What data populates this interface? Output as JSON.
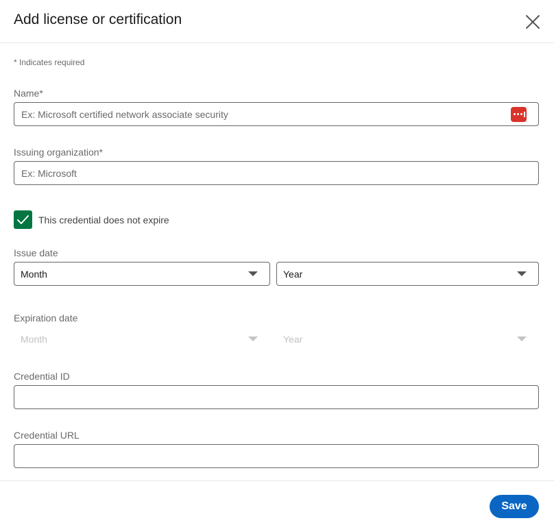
{
  "modal": {
    "title": "Add license or certification",
    "required_note": "* Indicates required"
  },
  "fields": {
    "name": {
      "label": "Name*",
      "placeholder": "Ex: Microsoft certified network associate security",
      "value": ""
    },
    "issuing_org": {
      "label": "Issuing organization*",
      "placeholder": "Ex: Microsoft",
      "value": ""
    },
    "no_expire": {
      "label": "This credential does not expire",
      "checked": true
    },
    "issue_date": {
      "label": "Issue date",
      "month": "Month",
      "year": "Year"
    },
    "expiration_date": {
      "label": "Expiration date",
      "month": "Month",
      "year": "Year",
      "disabled": true
    },
    "credential_id": {
      "label": "Credential ID",
      "value": ""
    },
    "credential_url": {
      "label": "Credential URL",
      "value": ""
    }
  },
  "footer": {
    "save_label": "Save"
  },
  "icons": {
    "close": "close-icon",
    "password_manager": "password-manager-icon",
    "checkmark": "checkmark-icon",
    "dropdown": "chevron-down-icon"
  },
  "colors": {
    "primary": "#0a66c2",
    "checkbox": "#057642",
    "password_manager": "#d9342b"
  }
}
